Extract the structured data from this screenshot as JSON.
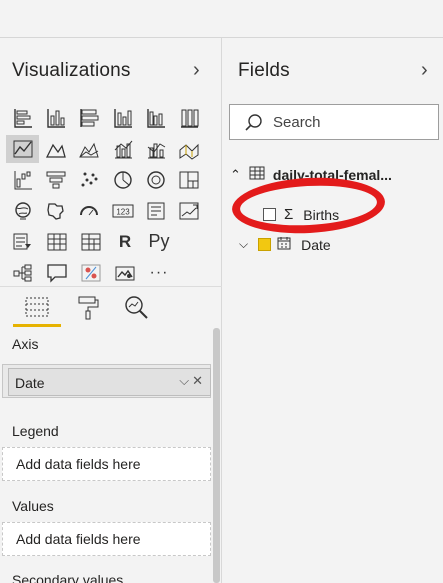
{
  "visualizations": {
    "title": "Visualizations",
    "expand_icon": "chevron-right-icon",
    "format_tabs": [
      {
        "name": "fields-tab",
        "icon": "fields-well-icon"
      },
      {
        "name": "format-tab",
        "icon": "paint-roller-icon"
      },
      {
        "name": "analytics-tab",
        "icon": "magnifier-analytics-icon"
      }
    ],
    "wells": {
      "axis": {
        "label": "Axis",
        "value": "Date"
      },
      "legend": {
        "label": "Legend",
        "placeholder": "Add data fields here"
      },
      "values": {
        "label": "Values",
        "placeholder": "Add data fields here"
      },
      "secondary_values": {
        "label": "Secondary values"
      }
    },
    "icons": [
      [
        "stacked-bar-icon",
        "clustered-bar-icon",
        "100-stacked-bar-icon",
        "stacked-column-icon",
        "clustered-column-icon",
        "100-stacked-column-icon"
      ],
      [
        "line-chart-icon",
        "area-chart-icon",
        "stacked-area-icon",
        "line-and-stacked-column-icon",
        "line-and-clustered-column-icon",
        "ribbon-chart-icon"
      ],
      [
        "waterfall-icon",
        "funnel-icon",
        "scatter-icon",
        "pie-icon",
        "donut-icon",
        "treemap-icon"
      ],
      [
        "map-icon",
        "filled-map-icon",
        "gauge-icon",
        "card-icon",
        "multi-row-card-icon",
        "kpi-icon"
      ],
      [
        "slicer-icon",
        "table-icon",
        "matrix-icon",
        "r-visual-icon",
        "python-visual-icon"
      ],
      [
        "decomposition-tree-icon",
        "qa-icon",
        "key-influencers-icon",
        "arcgis-icon",
        "more-icon"
      ]
    ],
    "r_label": "R",
    "py_label": "Py",
    "card_label": "123",
    "more_label": "···"
  },
  "fields": {
    "title": "Fields",
    "expand_icon": "chevron-right-icon",
    "search_placeholder": "Search",
    "table": {
      "name": "daily-total-femal...",
      "items": [
        {
          "label": "Births",
          "checked": false,
          "icon": "sigma-icon",
          "sigma": "Σ"
        },
        {
          "label": "Date",
          "checked": true,
          "icon": "calendar-icon"
        }
      ]
    }
  },
  "colors": {
    "accent_yellow": "#e6b200",
    "annotation_red": "#e31b1b"
  }
}
